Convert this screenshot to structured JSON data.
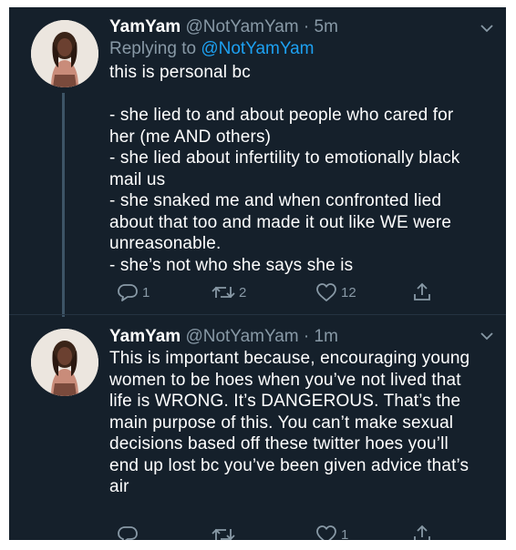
{
  "tweets": [
    {
      "name": "YamYam",
      "handle": "@NotYamYam",
      "separator": " · ",
      "time": "5m",
      "replying_prefix": "Replying to ",
      "replying_to": "@NotYamYam",
      "text": "this is personal bc\n\n- she lied to and about people who cared for her (me AND others)\n- she lied about infertility to emotionally black mail us\n- she snaked me and when confronted lied about that too and made it out like WE were unreasonable.\n- she’s not who she says she is",
      "replies": "1",
      "retweets": "2",
      "likes": "12"
    },
    {
      "name": "YamYam",
      "handle": "@NotYamYam",
      "separator": " · ",
      "time": "1m",
      "text": "This is important because, encouraging young women to be hoes when you’ve not lived that life is WRONG. It’s DANGEROUS. That’s the main purpose of this. You can’t make sexual decisions based off these twitter hoes you’ll end up lost bc you’ve been given advice that’s air",
      "replies": "",
      "retweets": "",
      "likes": "1"
    }
  ],
  "colors": {
    "background": "#15202b",
    "text": "#ffffff",
    "secondary": "#8899a6",
    "link": "#1da1f2"
  },
  "icons": [
    "avatar",
    "chevron-down-icon",
    "reply-icon",
    "retweet-icon",
    "like-icon",
    "share-icon"
  ]
}
